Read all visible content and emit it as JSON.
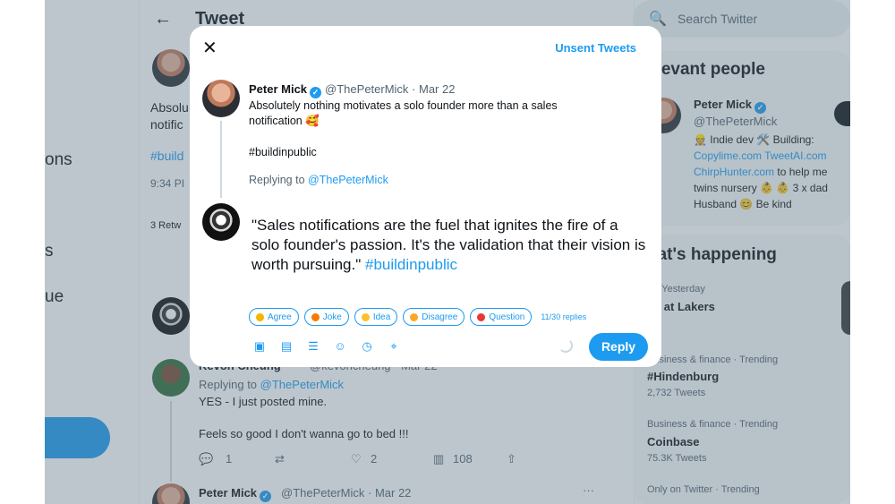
{
  "left_nav": {
    "items": [
      {
        "label": "ons"
      },
      {
        "label": "s"
      },
      {
        "label": "ue"
      }
    ]
  },
  "main": {
    "header_title": "Tweet",
    "tweet_text_partial": [
      "Absolu",
      "notific"
    ],
    "hashtag_partial": "#build",
    "time_partial": "9:34 PI",
    "retweets_partial": "3 Retw",
    "kevon_reply": {
      "name_partial": "Kevon Cheung",
      "handle_partial": "@kevoncheung · Mar 22",
      "replying_prefix": "Replying to",
      "replying_handle": "@ThePeterMick",
      "line1": "YES - I just posted mine.",
      "line2": "Feels so good I don't wanna go to bed !!!",
      "actions": {
        "replies": "1",
        "likes": "2",
        "views": "108"
      }
    },
    "bottom_tweet": {
      "name": "Peter Mick",
      "handle": "@ThePeterMick · Mar 22",
      "more": "···"
    }
  },
  "right": {
    "search_placeholder": "Search Twitter",
    "relevant_title": "elevant people",
    "person": {
      "name": "Peter Mick",
      "handle": "@ThePeterMick",
      "bio_line1": "👷 Indie dev 🛠️ Building:",
      "bio_link1": "Copylime.com TweetAI.com",
      "bio_link2": "ChirpHunter.com",
      "bio_line3": " to help me",
      "bio_line4": "twins nursery 👶 👶 3 x dad",
      "bio_line5": "Husband 😊 Be kind"
    },
    "happening_title": "hat's happening",
    "trends": [
      {
        "meta": "A · Yesterday",
        "name": "ns at Lakers",
        "sub": ""
      },
      {
        "meta": "Business & finance · Trending",
        "name": "#Hindenburg",
        "sub": "2,732 Tweets"
      },
      {
        "meta": "Business & finance · Trending",
        "name": "Coinbase",
        "sub": "75.3K Tweets"
      },
      {
        "meta": "Only on Twitter · Trending",
        "name": "",
        "sub": ""
      }
    ]
  },
  "modal": {
    "unsent_label": "Unsent Tweets",
    "orig": {
      "name": "Peter Mick",
      "handle_date": "@ThePeterMick · Mar 22",
      "body": "Absolutely nothing motivates a solo founder more than a sales notification 🥰",
      "hashtag": "#buildinpublic",
      "replying_prefix": "Replying to",
      "replying_handle": "@ThePeterMick"
    },
    "compose_text": "\"Sales notifications are the fuel that ignites the fire of a solo founder's passion. It's the validation that their vision is worth pursuing.\"",
    "compose_hashtag": "#buildinpublic",
    "chips": [
      {
        "label": "Agree",
        "color": "#f4b400"
      },
      {
        "label": "Joke",
        "color": "#f57c00"
      },
      {
        "label": "Idea",
        "color": "#fbc02d"
      },
      {
        "label": "Disagree",
        "color": "#f9a825"
      },
      {
        "label": "Question",
        "color": "#e53935"
      }
    ],
    "replies_count": "11/30 replies",
    "reply_button": "Reply"
  },
  "colors": {
    "accent": "#1d9bf0",
    "overlay": "rgba(91,112,131,0.40)"
  }
}
